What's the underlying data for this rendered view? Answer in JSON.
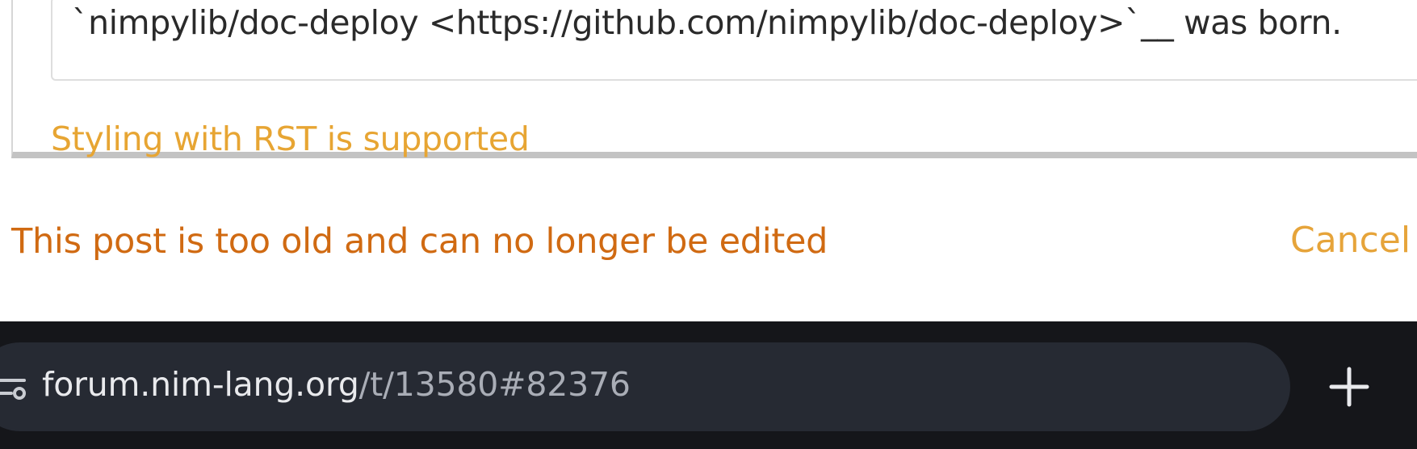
{
  "editor": {
    "text_line": "`nimpylib/doc-deploy <https://github.com/nimpylib/doc-deploy>`__ was born.",
    "rst_hint": "Styling with RST is supported"
  },
  "notice": {
    "message": "This post is too old and can no longer be edited",
    "cancel_label": "Cancel"
  },
  "browser": {
    "url_domain": "forum.nim-lang.org",
    "url_path": "/t/13580#82376",
    "icons": {
      "site_settings": "tune-icon",
      "new_tab": "plus-icon"
    },
    "colors": {
      "bar_bg": "#15161a",
      "pill_bg": "#262a33"
    }
  },
  "colors": {
    "notice": "#d06a12",
    "accent": "#e7a533"
  }
}
